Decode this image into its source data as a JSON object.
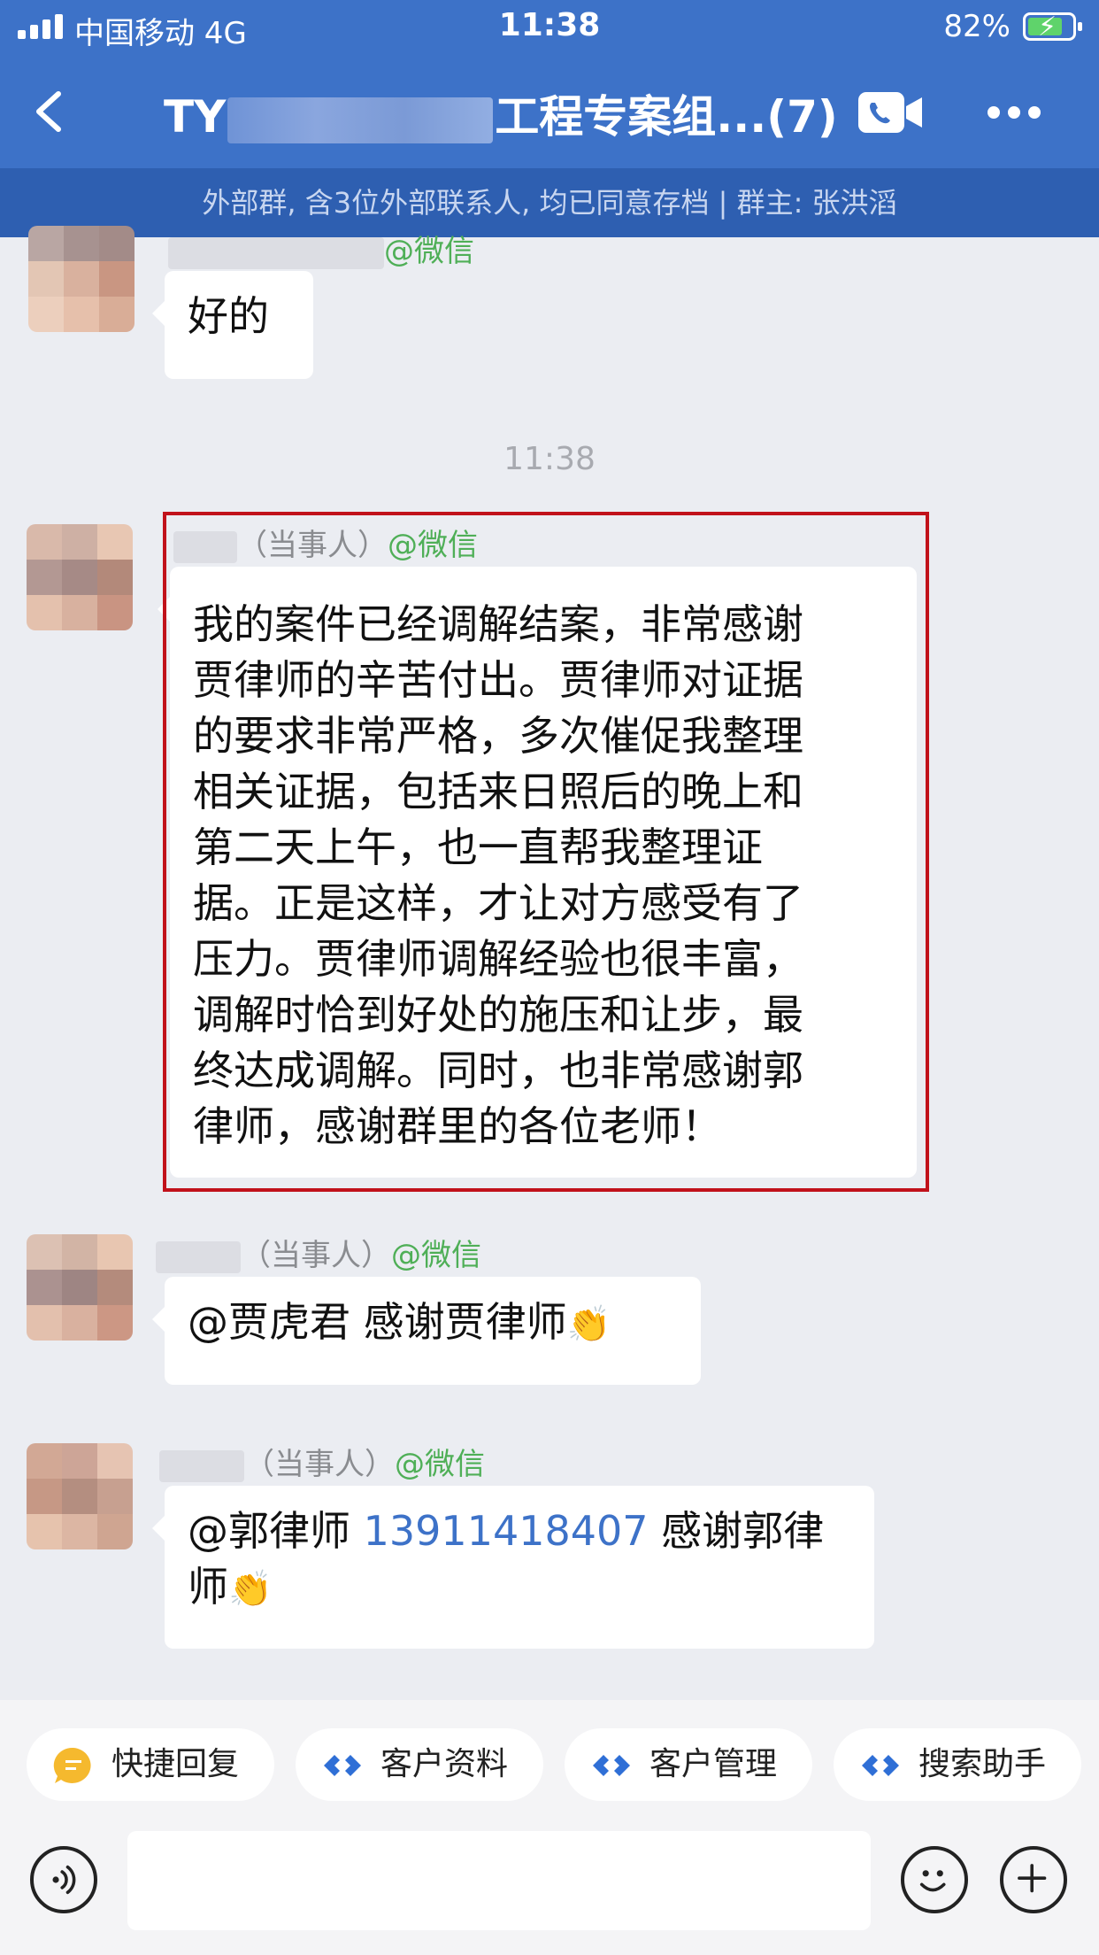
{
  "status": {
    "carrier": "中国移动  4G",
    "time": "11:38",
    "battery": "82%"
  },
  "nav": {
    "title_prefix": "TY",
    "title_suffix": "工程专案组...(7)"
  },
  "subbar": {
    "text": "外部群, 含3位外部联系人, 均已同意存档 | 群主: 张洪滔"
  },
  "timestamp": "11:38",
  "messages": [
    {
      "role": "",
      "source": "@微信",
      "text": "好的"
    },
    {
      "role": "（当事人）",
      "source": "@微信",
      "text_lines": [
        "我的案件已经调解结案，非常感谢",
        "贾律师的辛苦付出。贾律师对证据",
        "的要求非常严格，多次催促我整理",
        "相关证据，包括来日照后的晚上和",
        "第二天上午，也一直帮我整理证",
        "据。正是这样，才让对方感受有了",
        "压力。贾律师调解经验也很丰富，",
        "调解时恰到好处的施压和让步，最",
        "终达成调解。同时，也非常感谢郭",
        "律师，感谢群里的各位老师！"
      ]
    },
    {
      "role": "（当事人）",
      "source": "@微信",
      "text": "@贾虎君 感谢贾律师"
    },
    {
      "role": "（当事人）",
      "source": "@微信",
      "mention": "@郭律师 ",
      "phone": "13911418407",
      "after_phone": " 感谢郭律",
      "line2": "师"
    }
  ],
  "quick_actions": [
    "快捷回复",
    "客户资料",
    "客户管理",
    "搜索助手"
  ],
  "colors": {
    "header": "#3d72c8",
    "subbar": "#2e5fb1",
    "wechat_tag": "#4faf57",
    "link": "#3d72c8",
    "highlight": "#c1121b"
  },
  "icons": [
    "back-icon",
    "video-call-icon",
    "more-icon",
    "voice-icon",
    "emoji-icon",
    "add-icon"
  ]
}
